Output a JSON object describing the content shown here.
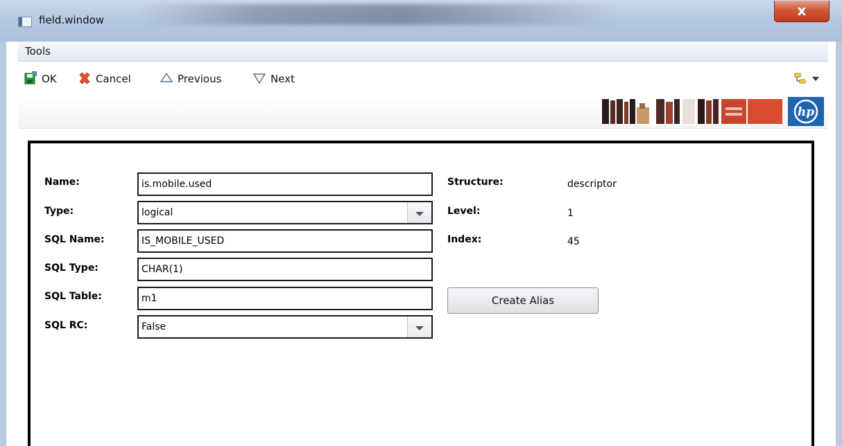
{
  "window": {
    "title": "field.window",
    "close_symbol": "x"
  },
  "menu": {
    "tools": "Tools"
  },
  "toolbar": {
    "ok": "OK",
    "cancel": "Cancel",
    "previous": "Previous",
    "next": "Next"
  },
  "banner": {
    "logo_text": "hp"
  },
  "form": {
    "name_label": "Name:",
    "name_value": "is.mobile.used",
    "type_label": "Type:",
    "type_value": "logical",
    "sql_name_label": "SQL Name:",
    "sql_name_value": "IS_MOBILE_USED",
    "sql_type_label": "SQL Type:",
    "sql_type_value": "CHAR(1)",
    "sql_table_label": "SQL Table:",
    "sql_table_value": "m1",
    "sql_rc_label": "SQL RC:",
    "sql_rc_value": "False",
    "structure_label": "Structure:",
    "structure_value": "descriptor",
    "level_label": "Level:",
    "level_value": "1",
    "index_label": "Index:",
    "index_value": "45",
    "create_alias": "Create Alias"
  },
  "colors": {
    "titlebar": "#b6c9e1",
    "close": "#c94a2e",
    "hp_blue": "#1d64b2",
    "panel_border": "#000000"
  }
}
